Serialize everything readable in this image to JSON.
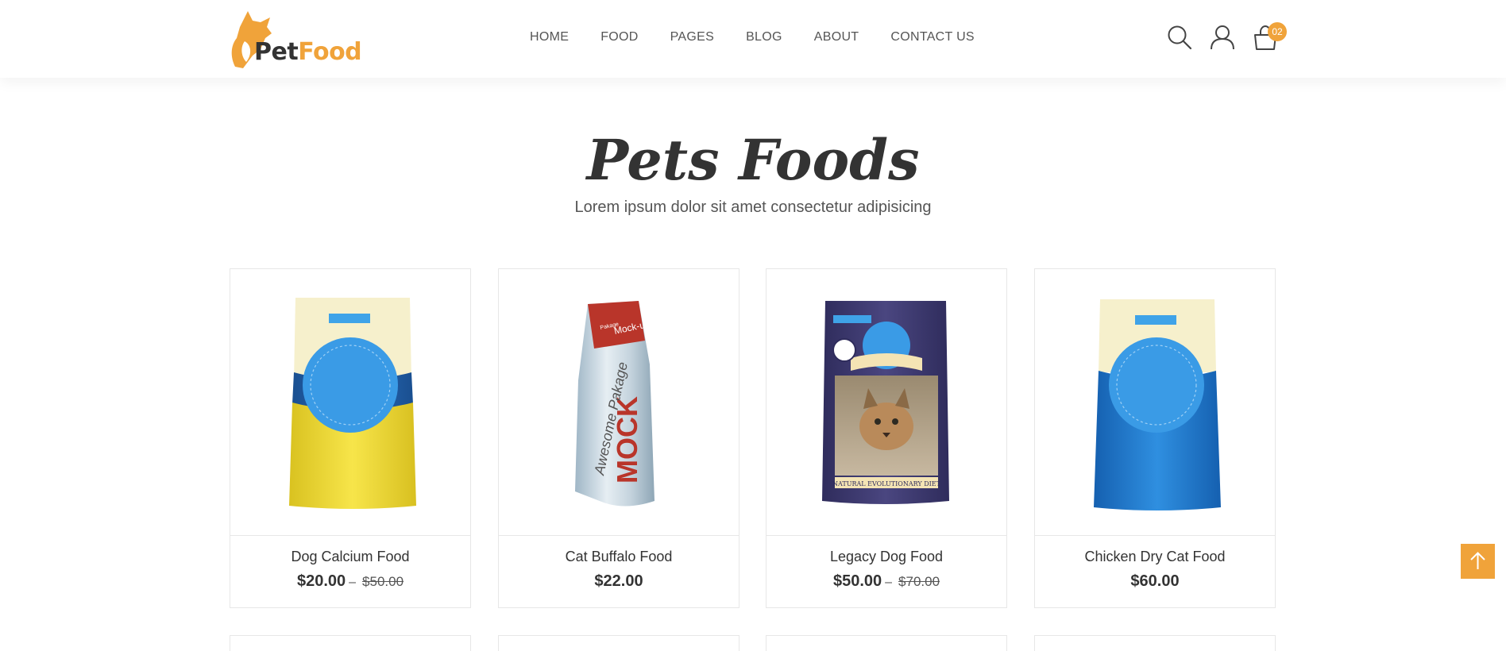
{
  "brand": {
    "pet": "Pet",
    "food": "Food",
    "accent": "#f0a33a"
  },
  "nav": {
    "items": [
      "HOME",
      "FOOD",
      "PAGES",
      "BLOG",
      "ABOUT",
      "CONTACT US"
    ]
  },
  "header_icons": {
    "search": "search-icon",
    "user": "user-icon",
    "cart": "shopping-bag-icon",
    "cart_count": "02"
  },
  "section": {
    "title": "Pets Foods",
    "subtitle": "Lorem ipsum dolor sit amet consectetur adipisicing"
  },
  "products": [
    {
      "name": "Dog Calcium Food",
      "price": "$20.00",
      "sep": "–",
      "old_price": "$50.00",
      "bag_color": "#f0da3a",
      "bag_type": "yellow-bag"
    },
    {
      "name": "Cat Buffalo Food",
      "price": "$22.00",
      "bag_type": "mock-bag",
      "bag_text": "MOCK",
      "bag_subtext": "Awesome Pakage",
      "bag_label": "Mock-up",
      "bag_small": "Pakage"
    },
    {
      "name": "Legacy Dog Food",
      "price": "$50.00",
      "sep": "–",
      "old_price": "$70.00",
      "bag_type": "lynx-bag",
      "bag_caption": "NATURAL EVOLUTIONARY DIET"
    },
    {
      "name": "Chicken Dry Cat Food",
      "price": "$60.00",
      "bag_color": "#2e8ad8",
      "bag_type": "blue-bag"
    }
  ]
}
